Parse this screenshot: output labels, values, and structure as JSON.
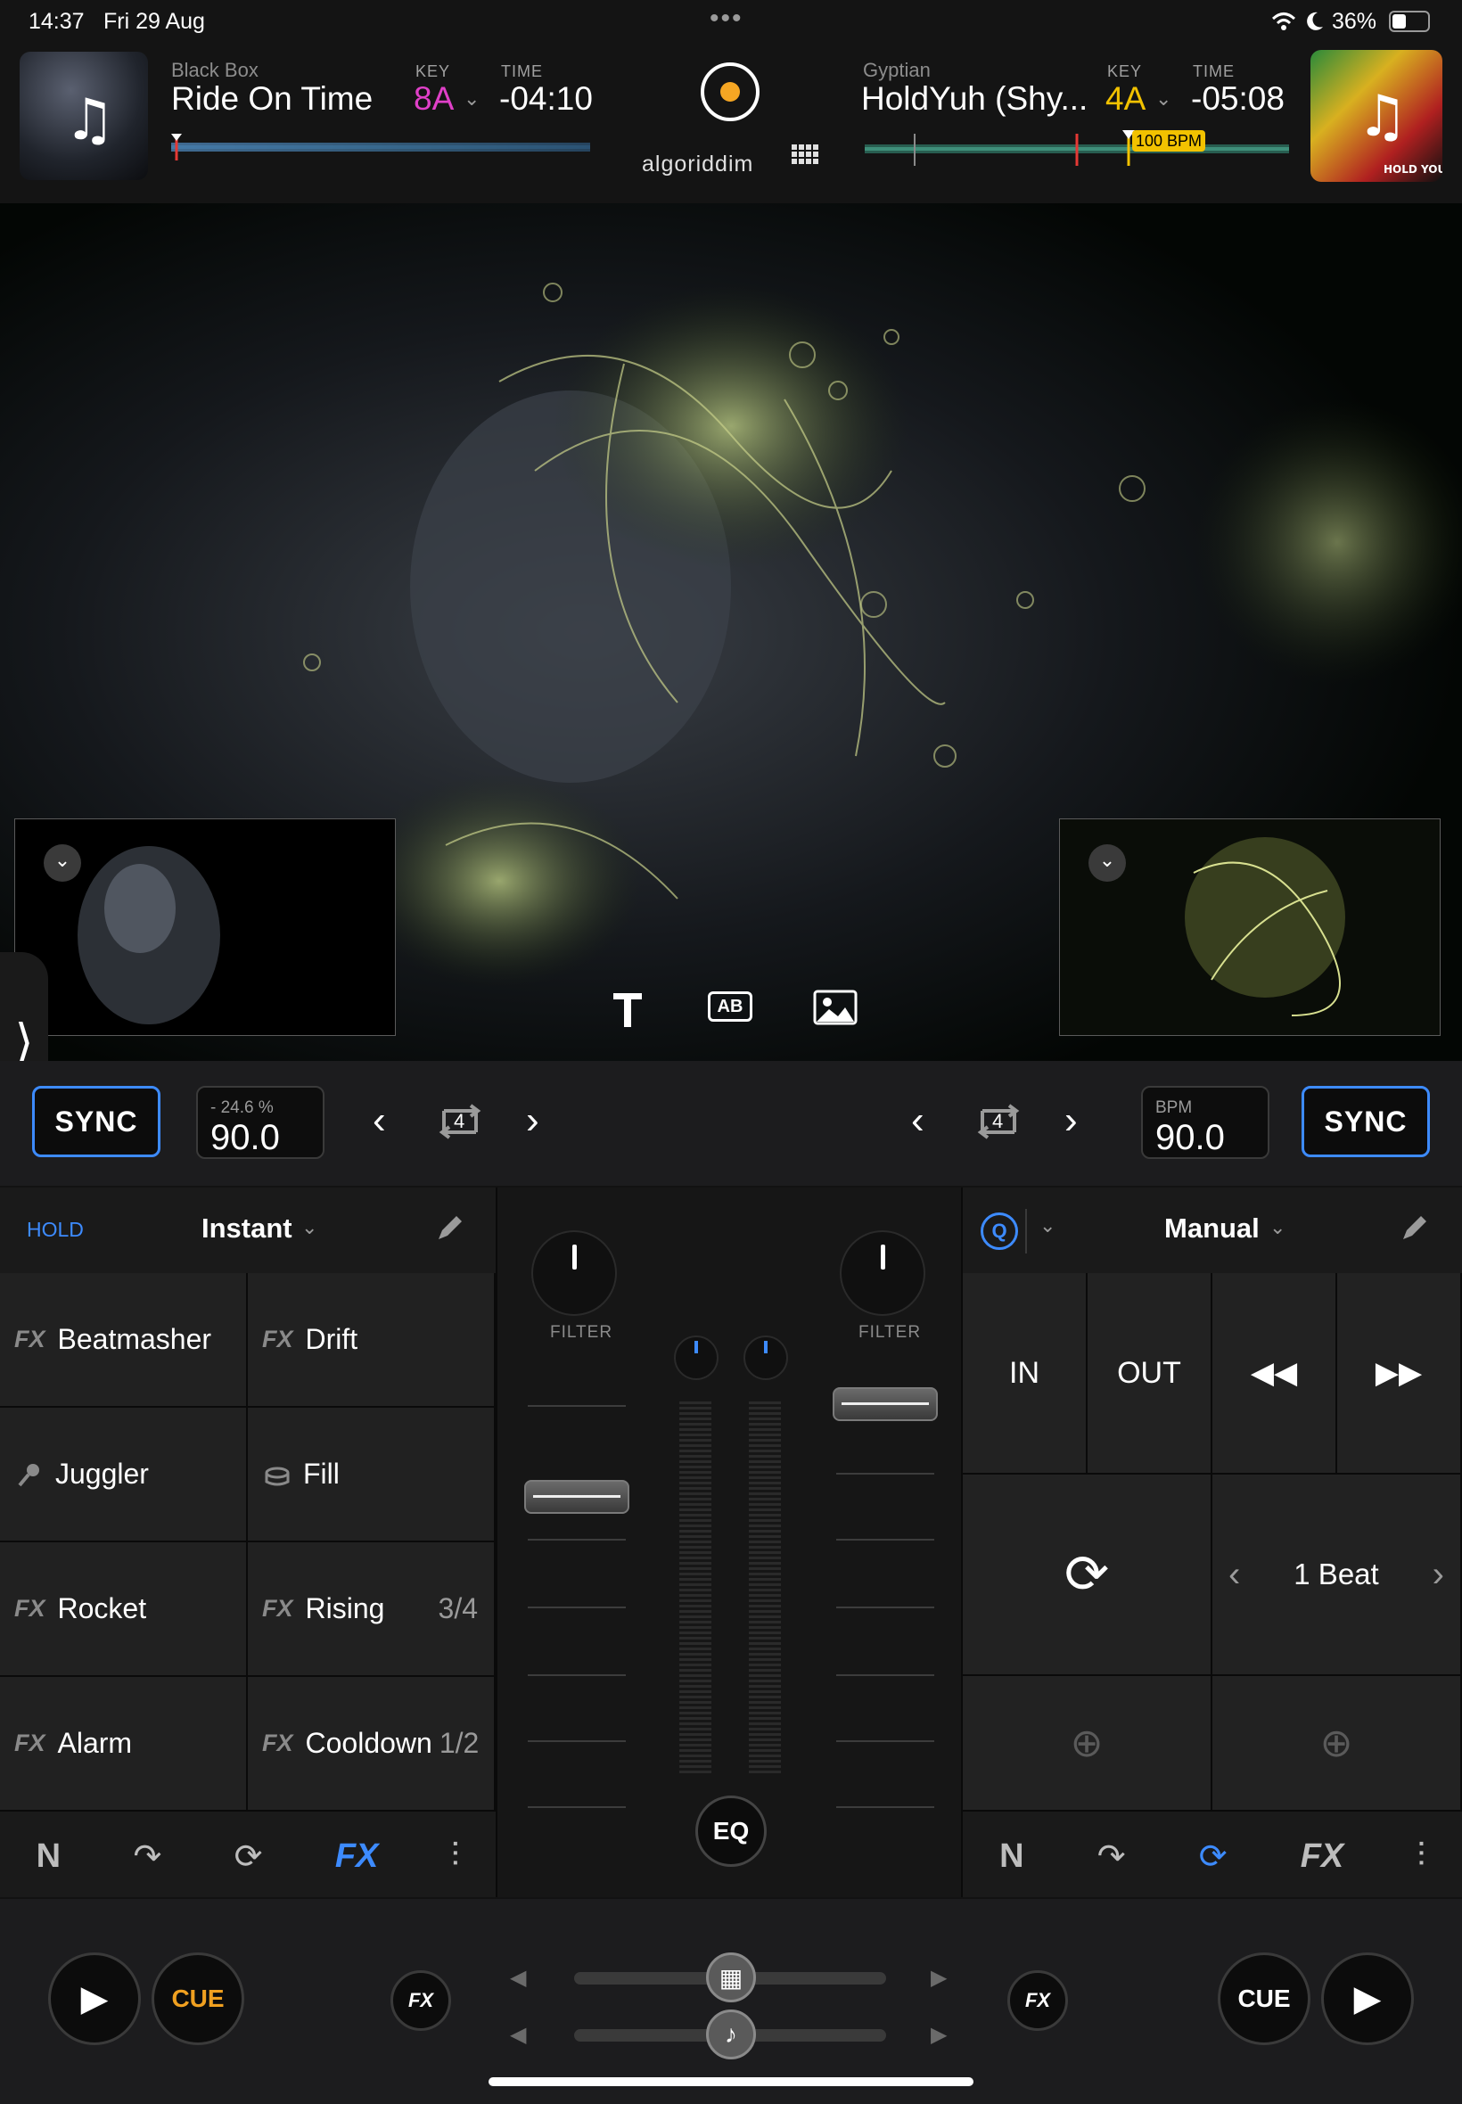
{
  "status": {
    "time": "14:37",
    "date": "Fri 29 Aug",
    "battery": "36%"
  },
  "deck_left": {
    "artist": "Black Box",
    "title": "Ride On Time",
    "key_label": "KEY",
    "key": "8A",
    "time_label": "TIME",
    "time": "-04:10",
    "key_color": "#e040c8"
  },
  "deck_right": {
    "artist": "Gyptian",
    "title": "HoldYuh (Shy...",
    "key_label": "KEY",
    "key": "4A",
    "time_label": "TIME",
    "time": "-05:08",
    "bpm_marker": "100 BPM",
    "key_color": "#f2c200"
  },
  "brand": {
    "name": "algoriddim"
  },
  "video_tools": {
    "text": "text-icon",
    "ab": "AB",
    "image": "image-icon"
  },
  "transport": {
    "left": {
      "sync": "SYNC",
      "pitch_label": "- 24.6 %",
      "bpm": "90.0",
      "loop_beats": "4"
    },
    "right": {
      "sync": "SYNC",
      "bpm_label": "BPM",
      "bpm": "90.0",
      "loop_beats": "4"
    }
  },
  "fx_panel": {
    "hold": "HOLD",
    "mode": "Instant",
    "pads": [
      {
        "icon": "FX",
        "name": "Beatmasher",
        "suffix": ""
      },
      {
        "icon": "FX",
        "name": "Drift",
        "suffix": ""
      },
      {
        "icon": "mic",
        "name": "Juggler",
        "suffix": ""
      },
      {
        "icon": "drum",
        "name": "Fill",
        "suffix": ""
      },
      {
        "icon": "FX",
        "name": "Rocket",
        "suffix": ""
      },
      {
        "icon": "FX",
        "name": "Rising",
        "suffix": "3/4"
      },
      {
        "icon": "FX",
        "name": "Alarm",
        "suffix": ""
      },
      {
        "icon": "FX",
        "name": "Cooldown",
        "suffix": "1/2"
      }
    ],
    "tabs_active": "FX"
  },
  "mixer": {
    "filter_left": "FILTER",
    "filter_right": "FILTER",
    "eq": "EQ"
  },
  "loop_panel": {
    "q": "Q",
    "mode": "Manual",
    "in": "IN",
    "out": "OUT",
    "beat_length": "1 Beat",
    "tabs_active": "loop"
  },
  "bottom": {
    "cue_left": "CUE",
    "cue_right": "CUE",
    "fx": "FX",
    "cue_left_color": "#f0a020"
  },
  "colors": {
    "accent": "#3d8bff"
  }
}
